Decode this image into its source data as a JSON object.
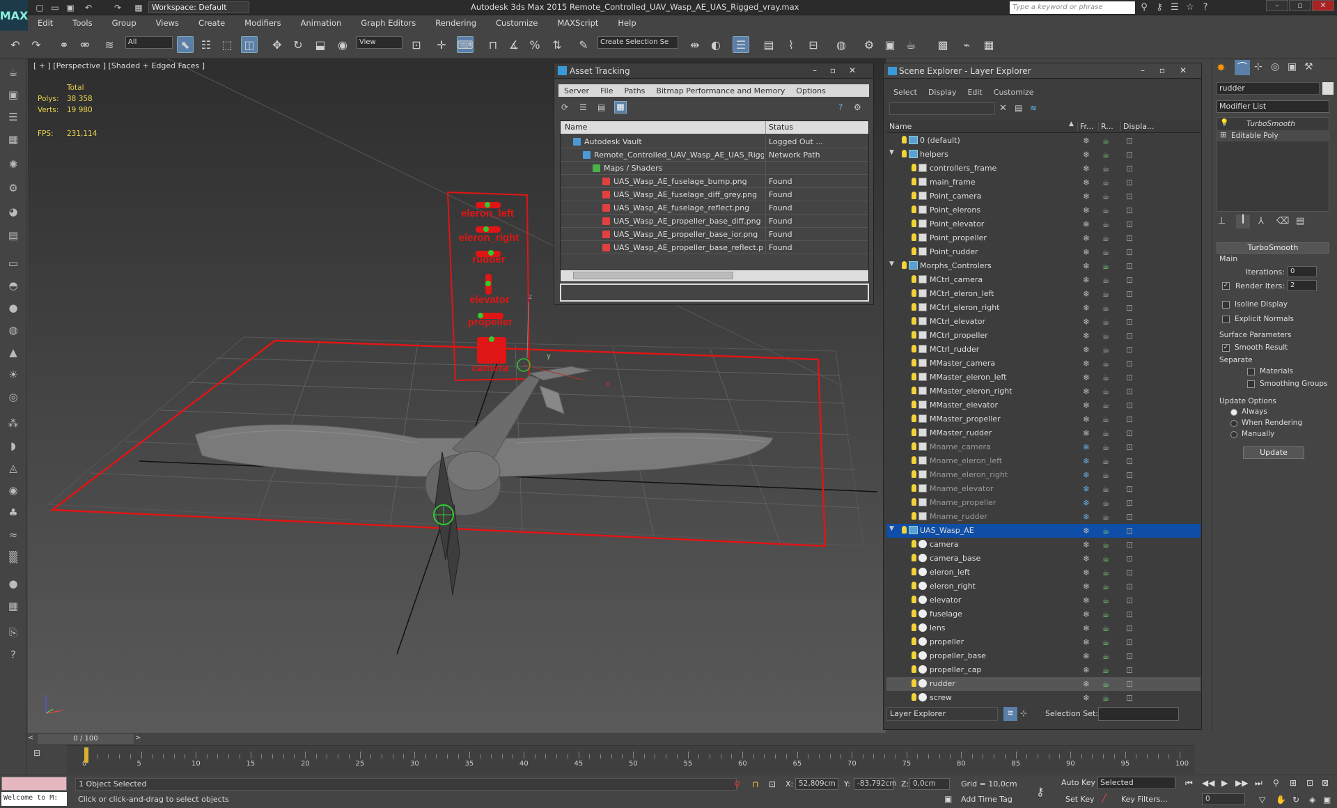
{
  "window": {
    "title": "Autodesk 3ds Max  2015    Remote_Controlled_UAV_Wasp_AE_UAS_Rigged_vray.max",
    "logo": "MAX",
    "workspace": "Workspace: Default",
    "search_placeholder": "Type a keyword or phrase"
  },
  "menu": [
    "Edit",
    "Tools",
    "Group",
    "Views",
    "Create",
    "Modifiers",
    "Animation",
    "Graph Editors",
    "Rendering",
    "Customize",
    "MAXScript",
    "Help"
  ],
  "toolbar": {
    "filter": "All",
    "coord_system": "View",
    "selection_set_placeholder": "Create Selection Se"
  },
  "viewport": {
    "label": "[ + ] [Perspective ] [Shaded + Edged Faces ]",
    "stats": {
      "total_label": "Total",
      "polys_label": "Polys:",
      "polys": "38 358",
      "verts_label": "Verts:",
      "verts": "19 980",
      "fps_label": "FPS:",
      "fps": "231,114"
    },
    "board_labels": [
      "eleron_left",
      "eleron_right",
      "rudder",
      "elevator",
      "propeller",
      "camera"
    ],
    "axis_labels": {
      "x": "x",
      "y": "y",
      "z": "z"
    }
  },
  "asset_tracking": {
    "title": "Asset Tracking",
    "menu": [
      "Server",
      "File",
      "Paths",
      "Bitmap Performance and Memory",
      "Options"
    ],
    "columns": [
      "Name",
      "Status"
    ],
    "rows": [
      {
        "name": "Autodesk Vault",
        "status": "Logged Out ...",
        "indent": 0
      },
      {
        "name": "Remote_Controlled_UAV_Wasp_AE_UAS_Rigged_vray....",
        "status": "Network Path",
        "indent": 1
      },
      {
        "name": "Maps / Shaders",
        "status": "",
        "indent": 2
      },
      {
        "name": "UAS_Wasp_AE_fuselage_bump.png",
        "status": "Found",
        "indent": 3
      },
      {
        "name": "UAS_Wasp_AE_fuselage_diff_grey.png",
        "status": "Found",
        "indent": 3
      },
      {
        "name": "UAS_Wasp_AE_fuselage_reflect.png",
        "status": "Found",
        "indent": 3
      },
      {
        "name": "UAS_Wasp_AE_propeller_base_diff.png",
        "status": "Found",
        "indent": 3
      },
      {
        "name": "UAS_Wasp_AE_propeller_base_ior.png",
        "status": "Found",
        "indent": 3
      },
      {
        "name": "UAS_Wasp_AE_propeller_base_reflect.png",
        "status": "Found",
        "indent": 3
      }
    ]
  },
  "scene_explorer": {
    "title": "Scene Explorer - Layer Explorer",
    "menu": [
      "Select",
      "Display",
      "Edit",
      "Customize"
    ],
    "columns": [
      "Name",
      "Fr...",
      "R...",
      "Displa..."
    ],
    "rows": [
      {
        "name": "0 (default)",
        "type": "layer",
        "indent": 0,
        "state": ""
      },
      {
        "name": "helpers",
        "type": "layer",
        "indent": 0,
        "expand": true,
        "state": ""
      },
      {
        "name": "controllers_frame",
        "type": "helper",
        "indent": 1,
        "state": ""
      },
      {
        "name": "main_frame",
        "type": "helper",
        "indent": 1,
        "state": ""
      },
      {
        "name": "Point_camera",
        "type": "helper",
        "indent": 1,
        "state": ""
      },
      {
        "name": "Point_elerons",
        "type": "helper",
        "indent": 1,
        "state": ""
      },
      {
        "name": "Point_elevator",
        "type": "helper",
        "indent": 1,
        "state": ""
      },
      {
        "name": "Point_propeller",
        "type": "helper",
        "indent": 1,
        "state": ""
      },
      {
        "name": "Point_rudder",
        "type": "helper",
        "indent": 1,
        "state": ""
      },
      {
        "name": "Morphs_Controlers",
        "type": "layer",
        "indent": 0,
        "expand": true,
        "state": ""
      },
      {
        "name": "MCtrl_camera",
        "type": "helper",
        "indent": 1,
        "state": ""
      },
      {
        "name": "MCtrl_eleron_left",
        "type": "helper",
        "indent": 1,
        "state": ""
      },
      {
        "name": "MCtrl_eleron_right",
        "type": "helper",
        "indent": 1,
        "state": ""
      },
      {
        "name": "MCtrl_elevator",
        "type": "helper",
        "indent": 1,
        "state": ""
      },
      {
        "name": "MCtrl_propeller",
        "type": "helper",
        "indent": 1,
        "state": ""
      },
      {
        "name": "MCtrl_rudder",
        "type": "helper",
        "indent": 1,
        "state": ""
      },
      {
        "name": "MMaster_camera",
        "type": "helper",
        "indent": 1,
        "state": ""
      },
      {
        "name": "MMaster_eleron_left",
        "type": "helper",
        "indent": 1,
        "state": ""
      },
      {
        "name": "MMaster_eleron_right",
        "type": "helper",
        "indent": 1,
        "state": ""
      },
      {
        "name": "MMaster_elevator",
        "type": "helper",
        "indent": 1,
        "state": ""
      },
      {
        "name": "MMaster_propeller",
        "type": "helper",
        "indent": 1,
        "state": ""
      },
      {
        "name": "MMaster_rudder",
        "type": "helper",
        "indent": 1,
        "state": ""
      },
      {
        "name": "Mname_camera",
        "type": "helper",
        "indent": 1,
        "state": "dim"
      },
      {
        "name": "Mname_eleron_left",
        "type": "helper",
        "indent": 1,
        "state": "dim"
      },
      {
        "name": "Mname_eleron_right",
        "type": "helper",
        "indent": 1,
        "state": "dim"
      },
      {
        "name": "Mname_elevator",
        "type": "helper",
        "indent": 1,
        "state": "dim"
      },
      {
        "name": "Mname_propeller",
        "type": "helper",
        "indent": 1,
        "state": "dim"
      },
      {
        "name": "Mname_rudder",
        "type": "helper",
        "indent": 1,
        "state": "dim"
      },
      {
        "name": "UAS_Wasp_AE",
        "type": "layer",
        "indent": 0,
        "expand": true,
        "state": "sel"
      },
      {
        "name": "camera",
        "type": "object",
        "indent": 1,
        "state": ""
      },
      {
        "name": "camera_base",
        "type": "object",
        "indent": 1,
        "state": ""
      },
      {
        "name": "eleron_left",
        "type": "object",
        "indent": 1,
        "state": ""
      },
      {
        "name": "eleron_right",
        "type": "object",
        "indent": 1,
        "state": ""
      },
      {
        "name": "elevator",
        "type": "object",
        "indent": 1,
        "state": ""
      },
      {
        "name": "fuselage",
        "type": "object",
        "indent": 1,
        "state": ""
      },
      {
        "name": "lens",
        "type": "object",
        "indent": 1,
        "state": ""
      },
      {
        "name": "propeller",
        "type": "object",
        "indent": 1,
        "state": ""
      },
      {
        "name": "propeller_base",
        "type": "object",
        "indent": 1,
        "state": ""
      },
      {
        "name": "propeller_cap",
        "type": "object",
        "indent": 1,
        "state": ""
      },
      {
        "name": "rudder",
        "type": "object",
        "indent": 1,
        "state": "hl"
      },
      {
        "name": "screw",
        "type": "object",
        "indent": 1,
        "state": ""
      }
    ],
    "footer_mode": "Layer Explorer",
    "selection_set_label": "Selection Set:"
  },
  "command_panel": {
    "object_name": "rudder",
    "modifier_list": "Modifier List",
    "stack": [
      "TurboSmooth",
      "Editable Poly"
    ],
    "rollout_title": "TurboSmooth",
    "main_label": "Main",
    "iterations_label": "Iterations:",
    "iterations": "0",
    "render_iters_label": "Render Iters:",
    "render_iters": "2",
    "isoline": "Isoline Display",
    "explicit_normals": "Explicit Normals",
    "surface_params": "Surface Parameters",
    "smooth_result": "Smooth Result",
    "separate": "Separate",
    "materials": "Materials",
    "smoothing_groups": "Smoothing Groups",
    "update_options": "Update Options",
    "always": "Always",
    "when_rendering": "When Rendering",
    "manually": "Manually",
    "update_button": "Update"
  },
  "timeline": {
    "frame": "0 / 100",
    "ticks": [
      "0",
      "5",
      "10",
      "15",
      "20",
      "25",
      "30",
      "35",
      "40",
      "45",
      "50",
      "55",
      "60",
      "65",
      "70",
      "75",
      "80",
      "85",
      "90",
      "95",
      "100"
    ]
  },
  "status": {
    "maxscript": "Welcome to M:",
    "selected": "1 Object Selected",
    "prompt": "Click or click-and-drag to select objects",
    "x_label": "X:",
    "x": "52,809cm",
    "y_label": "Y:",
    "y": "-83,792cm",
    "z_label": "Z:",
    "z": "0,0cm",
    "grid": "Grid = 10,0cm",
    "auto_key": "Auto Key",
    "key_mode": "Selected",
    "set_key": "Set Key",
    "key_filters": "Key Filters...",
    "add_time_tag": "Add Time Tag",
    "frame_field": "0"
  }
}
